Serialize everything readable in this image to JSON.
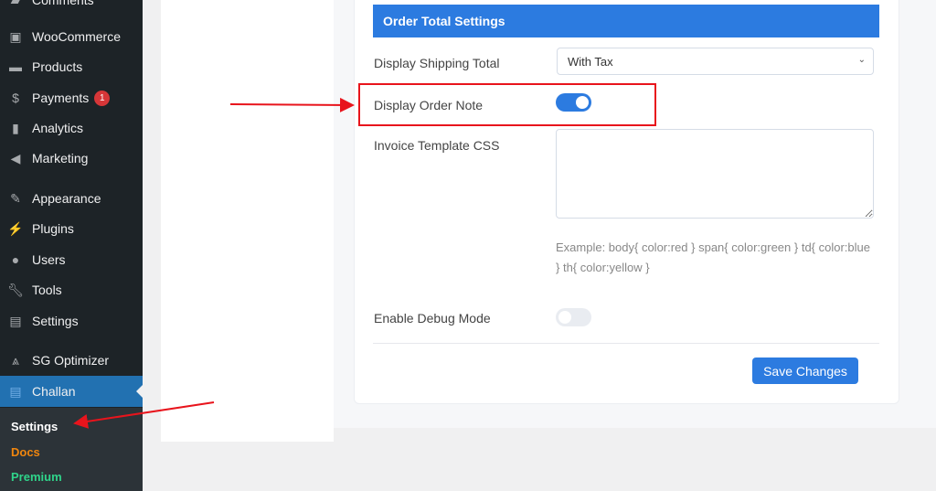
{
  "sidebar": {
    "items": [
      {
        "label": "Comments",
        "icon": "comments-icon"
      },
      {
        "label": "WooCommerce",
        "icon": "woo-icon"
      },
      {
        "label": "Products",
        "icon": "archive-icon"
      },
      {
        "label": "Payments",
        "icon": "dollar-icon",
        "badge": "1"
      },
      {
        "label": "Analytics",
        "icon": "bar-chart-icon"
      },
      {
        "label": "Marketing",
        "icon": "megaphone-icon"
      },
      {
        "label": "Appearance",
        "icon": "paintbrush-icon"
      },
      {
        "label": "Plugins",
        "icon": "plug-icon"
      },
      {
        "label": "Users",
        "icon": "user-icon"
      },
      {
        "label": "Tools",
        "icon": "wrench-icon"
      },
      {
        "label": "Settings",
        "icon": "sliders-icon"
      },
      {
        "label": "SG Optimizer",
        "icon": "sg-icon"
      },
      {
        "label": "Challan",
        "icon": "document-icon"
      }
    ],
    "submenu": [
      {
        "label": "Settings",
        "color": "#ffffff"
      },
      {
        "label": "Docs",
        "color": "#f0860e"
      },
      {
        "label": "Premium",
        "color": "#2fd48a"
      }
    ]
  },
  "section": {
    "title": "Order Total Settings",
    "accent": "#2c7be0"
  },
  "fields": {
    "shipping": {
      "label": "Display Shipping Total",
      "value": "With Tax"
    },
    "order_note": {
      "label": "Display Order Note",
      "enabled": true
    },
    "css": {
      "label": "Invoice Template CSS",
      "value": "",
      "hint": "Example: body{ color:red } span{ color:green } td{ color:blue } th{ color:yellow }"
    },
    "debug": {
      "label": "Enable Debug Mode",
      "enabled": false
    }
  },
  "save_label": "Save Changes",
  "annotation_color": "#e8141c"
}
